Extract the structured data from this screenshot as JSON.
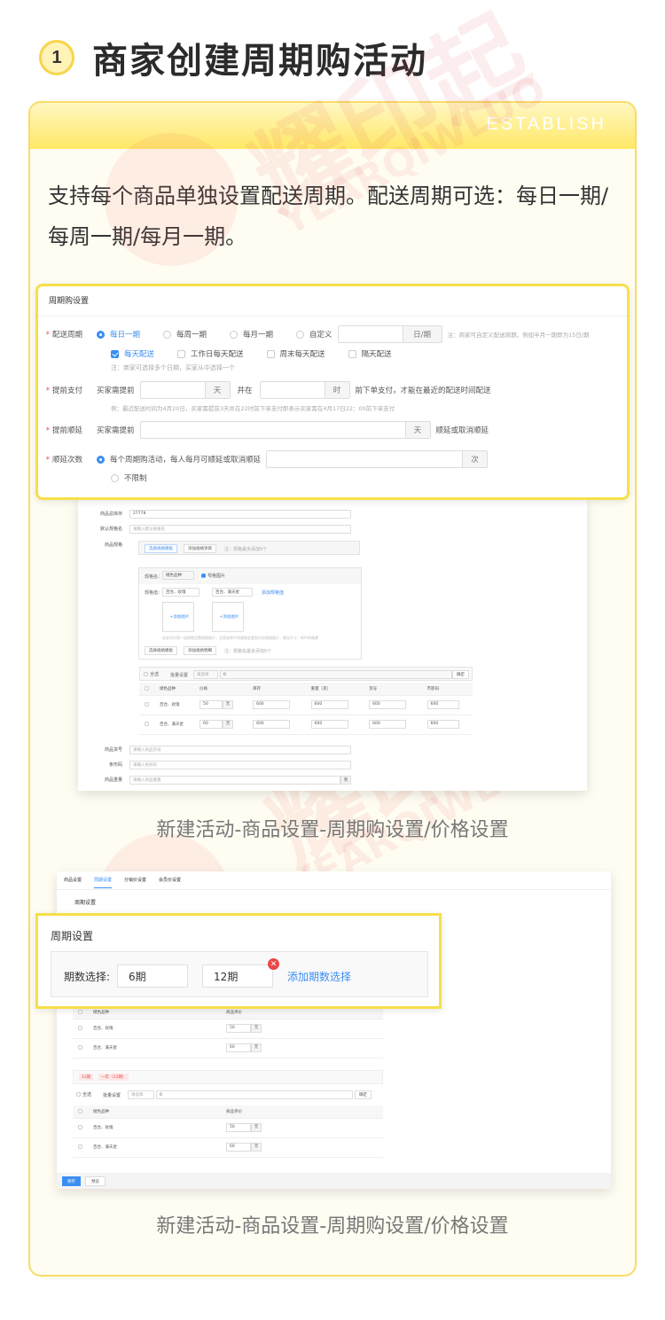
{
  "header": {
    "badge": "1",
    "title": "商家创建周期购活动"
  },
  "card": {
    "band_label": "ESTABLISH",
    "description": "支持每个商品单独设置配送周期。配送周期可选：每日一期/每周一期/每月一期。"
  },
  "watermark": {
    "brand_cn": "耀印起",
    "brand_en": "YEARQIWLUO"
  },
  "panel1": {
    "title": "周期购设置",
    "delivery_cycle": {
      "label": "配送周期",
      "options": [
        "每日一期",
        "每周一期",
        "每月一期",
        "自定义"
      ],
      "selected": "每日一期",
      "custom_unit": "日/期",
      "custom_hint": "注：商家可自定义配送周期，例如半月一期即为15日/期"
    },
    "delivery_days": {
      "options": [
        "每天配送",
        "工作日每天配送",
        "周末每天配送",
        "隔天配送"
      ],
      "checked": "每天配送",
      "hint": "注：商家可选择多个日期，买家从中选择一个"
    },
    "advance_pay": {
      "label": "提前支付",
      "prefix": "买家需提前",
      "unit_day": "天",
      "and_at": "并在",
      "unit_hour": "时",
      "suffix": "前下单支付，才能在最近的配送时间配送",
      "example": "例：最近配送时间为4月20日，买家需提前3天并在22时前下单支付即表示买家需在4月17日22：00前下单支付"
    },
    "advance_postpone": {
      "label": "提前顺延",
      "prefix": "买家需提前",
      "unit_day": "天",
      "suffix": "顺延或取消顺延"
    },
    "postpone_times": {
      "label": "顺延次数",
      "option_limited": "每个周期购活动，每人每月可顺延或取消顺延",
      "unit": "次",
      "option_unlimited": "不限制"
    }
  },
  "shot1": {
    "stock_label": "商品总库存",
    "stock_value": "27778",
    "spec_name_label": "默认规格名",
    "spec_name_placeholder": "请输入默认规格名",
    "spec_label": "商品规格",
    "btn_select_template": "选择规格模板",
    "btn_add_group": "添加规格项目",
    "group_hint": "注：规格最多添加5个",
    "spec_name_field": "规格名：",
    "spec_name_value": "储色品种",
    "spec_image_check": "规格图片",
    "spec_values_label": "规格值：",
    "spec_value_1": "百合、玫瑰",
    "spec_value_2": "百合、满天星",
    "add_spec_value": "添加规格值",
    "add_image": "+添加图片",
    "image_hint": "仅支持为第一组规格设置规格图片，买家选择不同规格会看到对应规格图片，建议尺寸：80*80像素",
    "btn_select_group": "选择规格模板",
    "btn_add_spec": "添加规格明细",
    "spec_hint": "注：规格名最多添加5个",
    "batch": {
      "select_all": "全选",
      "batch_label": "批量设置",
      "placeholder": "请选择",
      "value": "0",
      "confirm": "确定"
    },
    "table_headers": [
      "储色品种",
      "价格",
      "库存",
      "重量（克）",
      "货号",
      "市影码"
    ],
    "table_rows": [
      {
        "name": "百合、玫瑰",
        "price": "50",
        "unit": "元",
        "stock": "600",
        "weight": "600",
        "sku": "600",
        "code": "600"
      },
      {
        "name": "百合、满天星",
        "price": "60",
        "unit": "元",
        "stock": "600",
        "weight": "600",
        "sku": "600",
        "code": "600"
      }
    ],
    "goods_no_label": "商品货号",
    "goods_no_placeholder": "请输入商品货号",
    "barcode_label": "条形码",
    "barcode_placeholder": "请输入条形码",
    "weight_label": "商品重量",
    "weight_placeholder": "请输入商品重量",
    "weight_unit": "克"
  },
  "caption1": "新建活动-商品设置-周期购设置/价格设置",
  "shot2": {
    "tabs": [
      "商品设置",
      "周期设置",
      "分销价设置",
      "会员价设置"
    ],
    "active_tab": "周期设置",
    "section_title": "周期设置",
    "table_headers": [
      "储色品种",
      "商品单价"
    ],
    "group1_rows": [
      {
        "name": "百合、玫瑰",
        "price": "50",
        "unit": "元"
      },
      {
        "name": "百合、满天星",
        "price": "60",
        "unit": "元"
      }
    ],
    "tags": [
      "12期",
      "一年（12期）"
    ],
    "batch": {
      "select_all": "全选",
      "batch_label": "批量设置",
      "placeholder": "请选择",
      "value": "0",
      "confirm": "确定"
    },
    "group2_rows": [
      {
        "name": "百合、玫瑰",
        "price": "50",
        "unit": "元"
      },
      {
        "name": "百合、满天星",
        "price": "60",
        "unit": "元"
      }
    ],
    "btn_save": "保存",
    "btn_preview": "预览"
  },
  "panel2": {
    "title": "周期设置",
    "periods_label": "期数选择:",
    "periods": [
      "6期",
      "12期"
    ],
    "add_link": "添加期数选择"
  },
  "caption2": "新建活动-商品设置-周期购设置/价格设置",
  "colors": {
    "accent": "#3b8ef0",
    "highlight": "#f5e04a",
    "danger": "#e84747"
  }
}
